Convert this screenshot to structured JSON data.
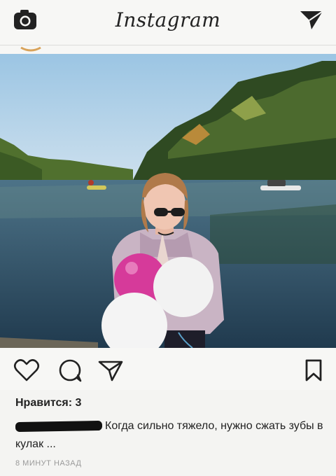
{
  "header": {
    "logo_text": "Instagram",
    "camera_icon": "camera-icon",
    "direct_icon": "direct-message-icon"
  },
  "post": {
    "image_alt": "",
    "actions": {
      "like_icon": "heart-icon",
      "comment_icon": "comment-icon",
      "share_icon": "share-icon",
      "save_icon": "bookmark-icon"
    },
    "likes_text": "Нравится: 3",
    "caption_text": "Когда сильно тяжело, нужно сжать зубы в кулак ...",
    "timestamp": "8 МИНУТ НАЗАД"
  },
  "colors": {
    "background": "#f4f4f2",
    "balloon_pink": "#d63a9a",
    "balloon_white": "#f2f2f2"
  }
}
